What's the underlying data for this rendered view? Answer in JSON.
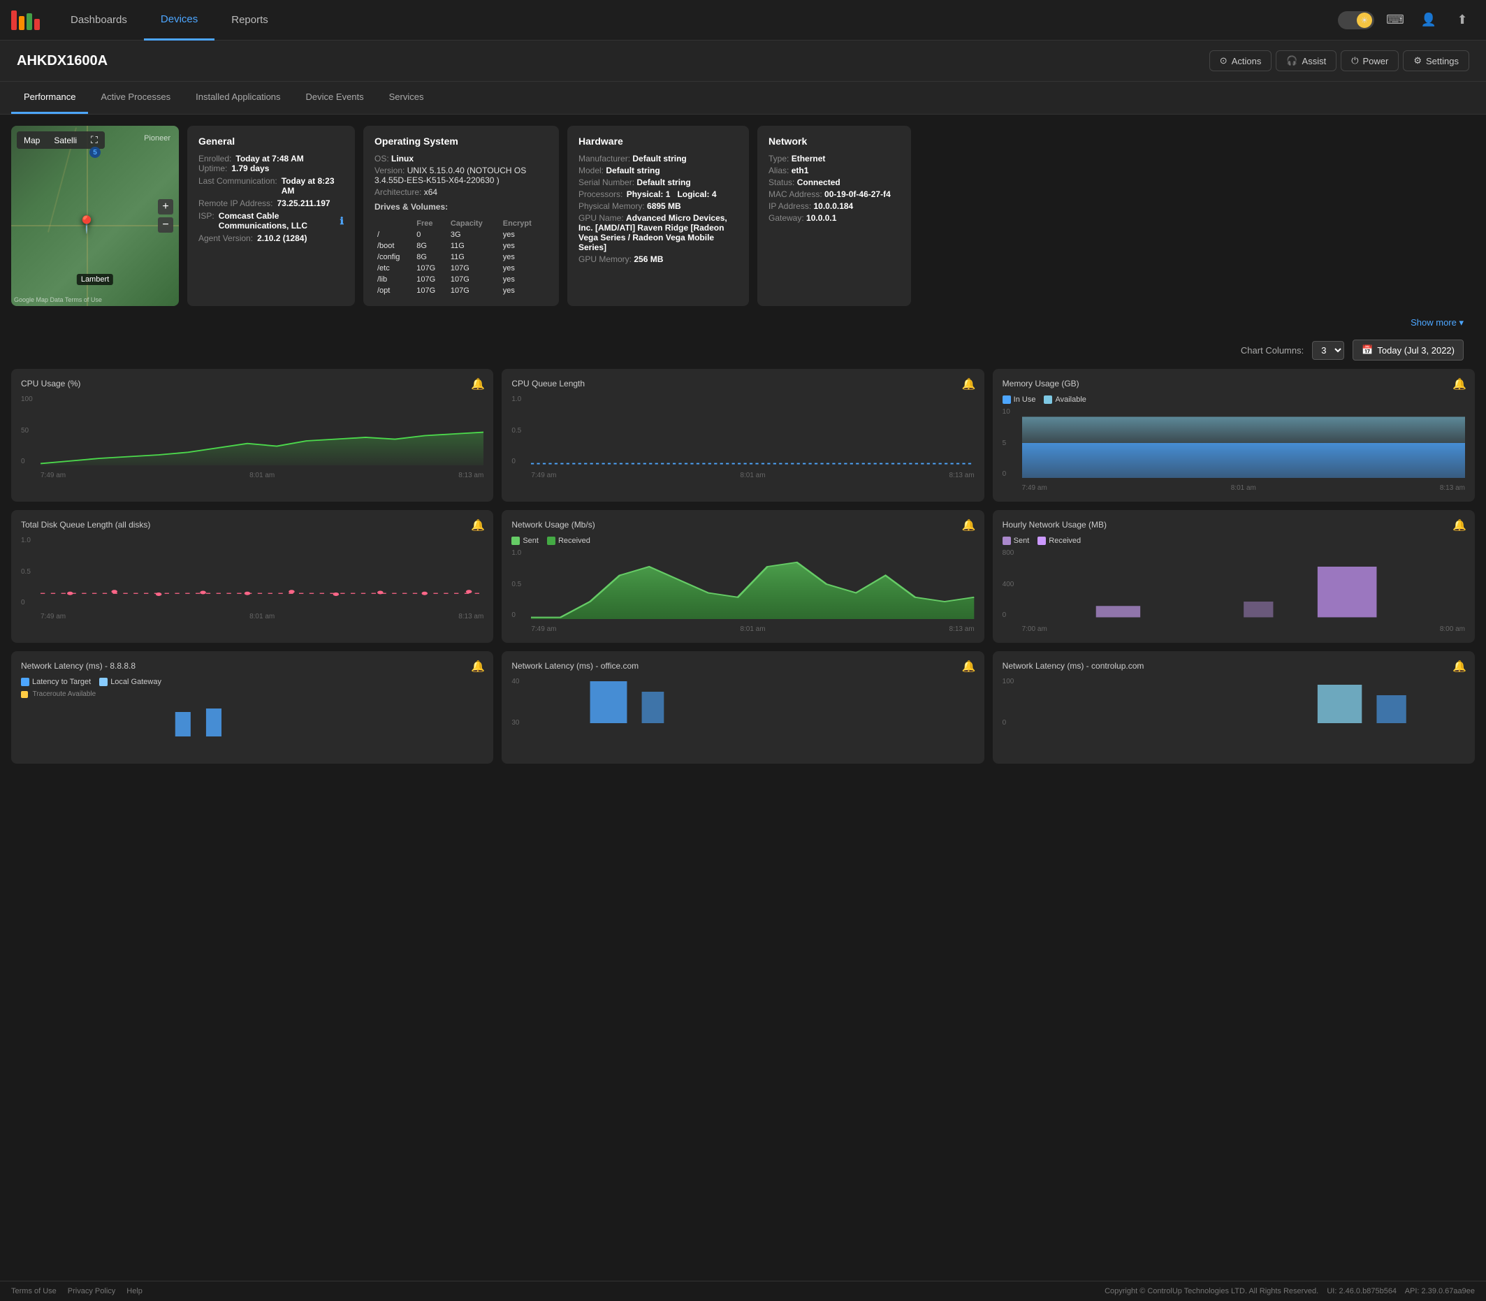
{
  "nav": {
    "dashboards_label": "Dashboards",
    "devices_label": "Devices",
    "reports_label": "Reports",
    "theme_icon": "☀",
    "keyboard_icon": "⌨",
    "user_icon": "👤",
    "export_icon": "⬆"
  },
  "device": {
    "title": "AHKDX1600A",
    "actions_label": "Actions",
    "assist_label": "Assist",
    "power_label": "Power",
    "settings_label": "Settings"
  },
  "tabs": [
    {
      "label": "Performance",
      "active": true
    },
    {
      "label": "Active Processes",
      "active": false
    },
    {
      "label": "Installed Applications",
      "active": false
    },
    {
      "label": "Device Events",
      "active": false
    },
    {
      "label": "Services",
      "active": false
    }
  ],
  "general": {
    "title": "General",
    "enrolled_label": "Enrolled:",
    "enrolled_value": "Today at 7:48 AM",
    "uptime_label": "Uptime:",
    "uptime_value": "1.79 days",
    "last_comm_label": "Last Communication:",
    "last_comm_value": "Today at 8:23 AM",
    "remote_ip_label": "Remote IP Address:",
    "remote_ip_value": "73.25.211.197",
    "isp_label": "ISP:",
    "isp_value": "Comcast Cable Communications, LLC",
    "agent_label": "Agent Version:",
    "agent_value": "2.10.2 (1284)"
  },
  "os": {
    "title": "Operating System",
    "os_label": "OS:",
    "os_value": "Linux",
    "version_label": "Version:",
    "version_value": "UNIX 5.15.0.40 (NOTOUCH OS 3.4.55D-EES-K515-X64-220630 )",
    "arch_label": "Architecture:",
    "arch_value": "x64",
    "drives_label": "Drives & Volumes:",
    "drives": [
      {
        "path": "/",
        "free": "0",
        "capacity": "3G",
        "encrypt": "yes"
      },
      {
        "path": "/boot",
        "free": "8G",
        "capacity": "11G",
        "encrypt": "yes"
      },
      {
        "path": "/config",
        "free": "8G",
        "capacity": "11G",
        "encrypt": "yes"
      },
      {
        "path": "/etc",
        "free": "107G",
        "capacity": "107G",
        "encrypt": "yes"
      },
      {
        "path": "/lib",
        "free": "107G",
        "capacity": "107G",
        "encrypt": "yes"
      },
      {
        "path": "/opt",
        "free": "107G",
        "capacity": "107G",
        "encrypt": "yes"
      }
    ]
  },
  "hardware": {
    "title": "Hardware",
    "manufacturer_label": "Manufacturer:",
    "manufacturer_value": "Default string",
    "model_label": "Model:",
    "model_value": "Default string",
    "serial_label": "Serial Number:",
    "serial_value": "Default string",
    "processors_label": "Processors:",
    "physical_label": "Physical:",
    "physical_value": "1",
    "logical_label": "Logical:",
    "logical_value": "4",
    "phys_mem_label": "Physical Memory:",
    "phys_mem_value": "6895 MB",
    "gpu_name_label": "GPU Name:",
    "gpu_name_value": "Advanced Micro Devices, Inc. [AMD/ATI] Raven Ridge [Radeon Vega Series / Radeon Vega Mobile Series]",
    "gpu_mem_label": "GPU Memory:",
    "gpu_mem_value": "256 MB"
  },
  "network": {
    "title": "Network",
    "type_label": "Type:",
    "type_value": "Ethernet",
    "alias_label": "Alias:",
    "alias_value": "eth1",
    "status_label": "Status:",
    "status_value": "Connected",
    "mac_label": "MAC Address:",
    "mac_value": "00-19-0f-46-27-f4",
    "ip_label": "IP Address:",
    "ip_value": "10.0.0.184",
    "gateway_label": "Gateway:",
    "gateway_value": "10.0.0.1"
  },
  "show_more": "Show more",
  "chart_controls": {
    "columns_label": "Chart Columns:",
    "columns_value": "3",
    "date_icon": "📅",
    "date_value": "Today (Jul 3, 2022)"
  },
  "charts": [
    {
      "id": "cpu-usage",
      "title": "CPU Usage (%)",
      "y_max": "100",
      "y_mid": "50",
      "y_min": "0",
      "x_labels": [
        "7:49 am",
        "8:01 am",
        "8:13 am"
      ],
      "color": "#4cd94c",
      "type": "line"
    },
    {
      "id": "cpu-queue",
      "title": "CPU Queue Length",
      "y_max": "1.0",
      "y_mid": "0.5",
      "y_min": "0",
      "x_labels": [
        "7:49 am",
        "8:01 am",
        "8:13 am"
      ],
      "color": "#4da6ff",
      "type": "line_flat"
    },
    {
      "id": "memory-usage",
      "title": "Memory Usage (GB)",
      "y_max": "10",
      "y_mid": "5",
      "y_min": "0",
      "x_labels": [
        "7:49 am",
        "8:01 am",
        "8:13 am"
      ],
      "legend": [
        {
          "label": "In Use",
          "color": "#4da6ff"
        },
        {
          "label": "Available",
          "color": "#7ec8e3"
        }
      ],
      "type": "area_stacked"
    },
    {
      "id": "disk-queue",
      "title": "Total Disk Queue Length (all disks)",
      "y_max": "1.0",
      "y_mid": "0.5",
      "y_min": "0",
      "x_labels": [
        "7:49 am",
        "8:01 am",
        "8:13 am"
      ],
      "color": "#ff6688",
      "type": "line_dots"
    },
    {
      "id": "network-usage",
      "title": "Network Usage (Mb/s)",
      "y_max": "1.0",
      "y_mid": "0.5",
      "y_min": "0",
      "x_labels": [
        "7:49 am",
        "8:01 am",
        "8:13 am"
      ],
      "legend": [
        {
          "label": "Sent",
          "color": "#66cc66"
        },
        {
          "label": "Received",
          "color": "#44aa44"
        }
      ],
      "type": "area_network"
    },
    {
      "id": "hourly-network",
      "title": "Hourly Network Usage (MB)",
      "y_max": "800",
      "y_mid": "400",
      "y_min": "0",
      "x_labels": [
        "7:00 am",
        "8:00 am"
      ],
      "legend": [
        {
          "label": "Sent",
          "color": "#aa88cc"
        },
        {
          "label": "Received",
          "color": "#cc99ff"
        }
      ],
      "type": "bar_hourly"
    },
    {
      "id": "net-latency-8888",
      "title": "Network Latency (ms) - 8.8.8.8",
      "y_max": "",
      "y_mid": "",
      "y_min": "",
      "x_labels": [],
      "legend": [
        {
          "label": "Latency to Target",
          "color": "#4da6ff"
        },
        {
          "label": "Local Gateway",
          "color": "#88ccff"
        }
      ],
      "type": "latency_partial"
    },
    {
      "id": "net-latency-office",
      "title": "Network Latency (ms) - office.com",
      "y_max": "40",
      "y_mid": "",
      "y_min": "30",
      "x_labels": [],
      "type": "latency_office"
    },
    {
      "id": "net-latency-controlup",
      "title": "Network Latency (ms) - controlup.com",
      "y_max": "100",
      "y_mid": "",
      "y_min": "",
      "x_labels": [],
      "type": "latency_controlup"
    }
  ],
  "footer": {
    "terms_label": "Terms of Use",
    "privacy_label": "Privacy Policy",
    "help_label": "Help",
    "copyright": "Copyright © ControlUp Technologies LTD. All Rights Reserved.",
    "ui_version": "UI: 2.46.0.b875b564",
    "api_version": "API: 2.39.0.67aa9ee"
  },
  "map": {
    "map_label": "Map",
    "satellite_label": "Satelli",
    "location_label": "Lambert",
    "pioneer_label": "Pioneer",
    "zoom_in": "+",
    "zoom_out": "−",
    "footer_text": "Google  Map Data  Terms of Use"
  }
}
